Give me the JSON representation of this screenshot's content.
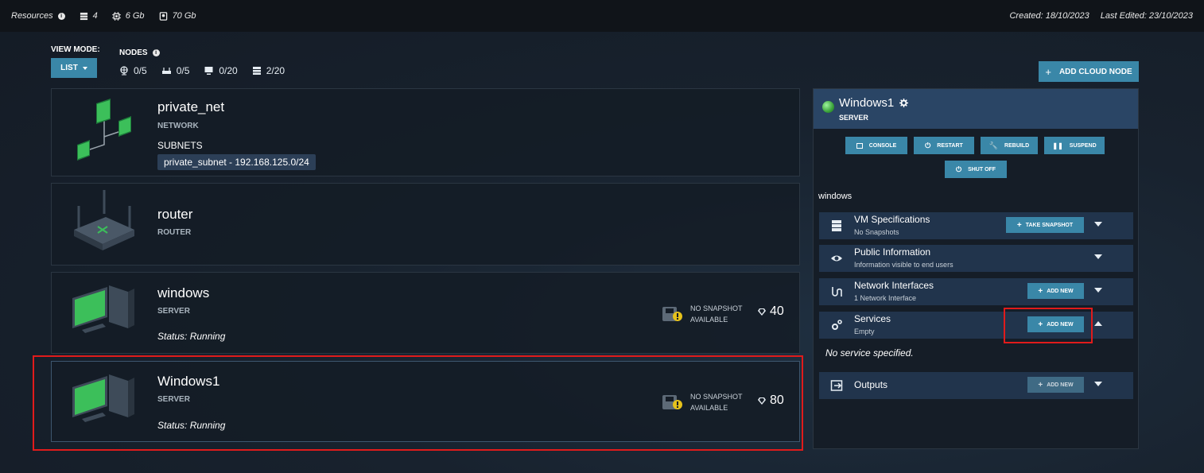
{
  "topbar": {
    "resources_label": "Resources",
    "cpu": "4",
    "memory": "6 Gb",
    "storage": "70 Gb",
    "created": "Created: 18/10/2023",
    "last_edited": "Last Edited: 23/10/2023"
  },
  "toolbar": {
    "view_mode_label": "VIEW MODE:",
    "view_mode_value": "LIST",
    "nodes_label": "NODES",
    "counts": {
      "network": "0/5",
      "router": "0/5",
      "desktop": "0/20",
      "server": "2/20"
    },
    "add_cloud_node": "ADD CLOUD NODE"
  },
  "nodes": [
    {
      "title": "private_net",
      "type": "NETWORK",
      "subnets_label": "SUBNETS",
      "subnet": "private_subnet - 192.168.125.0/24"
    },
    {
      "title": "router",
      "type": "ROUTER"
    },
    {
      "title": "windows",
      "type": "SERVER",
      "status": "Status: Running",
      "snapshot_line1": "NO SNAPSHOT",
      "snapshot_line2": "AVAILABLE",
      "cost": "40"
    },
    {
      "title": "Windows1",
      "type": "SERVER",
      "status": "Status: Running",
      "snapshot_line1": "NO SNAPSHOT",
      "snapshot_line2": "AVAILABLE",
      "cost": "80"
    }
  ],
  "panel": {
    "name": "Windows1",
    "kind": "SERVER",
    "actions": {
      "console": "CONSOLE",
      "restart": "RESTART",
      "rebuild": "REBUILD",
      "suspend": "SUSPEND",
      "shutoff": "SHUT OFF"
    },
    "description": "windows",
    "sections": {
      "vm_spec": {
        "title": "VM Specifications",
        "subtitle": "No Snapshots",
        "button": "TAKE SNAPSHOT"
      },
      "public_info": {
        "title": "Public Information",
        "subtitle": "Information visible to end users"
      },
      "network_interfaces": {
        "title": "Network Interfaces",
        "subtitle": "1 Network Interface",
        "button": "ADD NEW"
      },
      "services": {
        "title": "Services",
        "subtitle": "Empty",
        "button": "ADD NEW",
        "empty_text": "No service specified."
      },
      "outputs": {
        "title": "Outputs",
        "button": "ADD NEW"
      }
    }
  },
  "colors": {
    "accent": "#3a87a8",
    "highlight": "#e01b1b",
    "running": "#3aa23a"
  }
}
